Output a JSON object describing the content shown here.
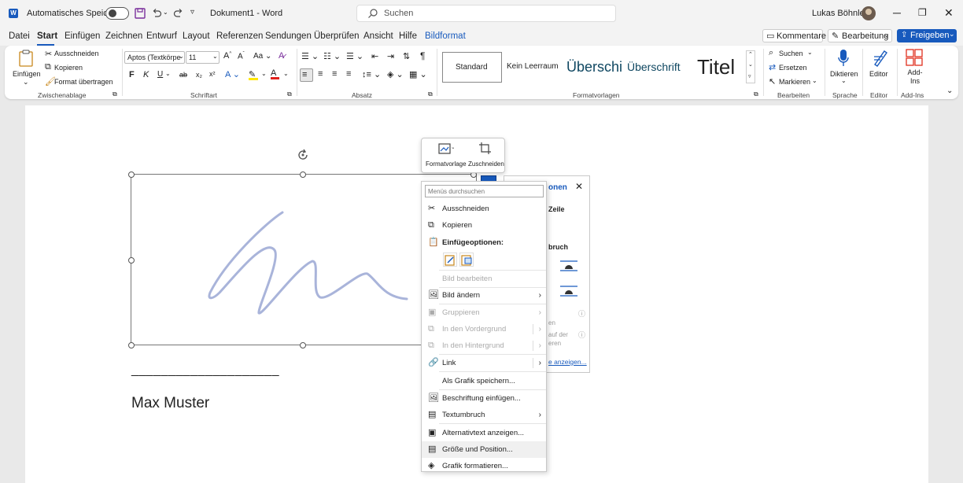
{
  "titlebar": {
    "autosave_label": "Automatisches Speichern",
    "doc_title": "Dokument1  -  Word",
    "search_placeholder": "Suchen",
    "user_name": "Lukas Böhnlein"
  },
  "menu_tabs": [
    "Datei",
    "Start",
    "Einfügen",
    "Zeichnen",
    "Entwurf",
    "Layout",
    "Referenzen",
    "Sendungen",
    "Überprüfen",
    "Ansicht",
    "Hilfe",
    "Bildformat"
  ],
  "active_tab": "Start",
  "right_buttons": {
    "comments": "Kommentare",
    "editing": "Bearbeitung",
    "share": "Freigeben"
  },
  "ribbon": {
    "clipboard": {
      "paste": "Einfügen",
      "cut": "Ausschneiden",
      "copy": "Kopieren",
      "format_painter": "Format übertragen",
      "label": "Zwischenablage"
    },
    "font": {
      "name": "Aptos (Textkörpe",
      "size": "11",
      "label": "Schriftart",
      "bold": "F",
      "italic": "K",
      "underline": "U",
      "strike": "ab",
      "sub": "x₂",
      "sup": "x²",
      "grow": "A^",
      "shrink": "Aˇ",
      "case": "Aa"
    },
    "paragraph": {
      "label": "Absatz"
    },
    "styles": {
      "items": [
        "Standard",
        "Kein Leerraum",
        "Überschi",
        "Überschrift",
        "Titel"
      ],
      "label": "Formatvorlagen"
    },
    "editing": {
      "find": "Suchen",
      "replace": "Ersetzen",
      "select": "Markieren",
      "label": "Bearbeiten"
    },
    "voice": {
      "dictate": "Diktieren",
      "label": "Sprache"
    },
    "editor": {
      "button": "Editor",
      "label": "Editor"
    },
    "addins": {
      "button": "Add-Ins",
      "label": "Add-Ins"
    }
  },
  "document": {
    "signature_line": "____________________",
    "name": "Max Muster"
  },
  "mini_toolbar": {
    "style": "Formatvorlage",
    "crop": "Zuschneiden"
  },
  "layout_panel": {
    "title": "onen",
    "line": "Zeile",
    "wrap": "bruch",
    "t1": "en",
    "t2": "auf der",
    "t3": "eren",
    "link": "e anzeigen..."
  },
  "context_menu": {
    "search_placeholder": "Menüs durchsuchen",
    "items": {
      "cut": "Ausschneiden",
      "copy": "Kopieren",
      "paste_options": "Einfügeoptionen:",
      "edit_image": "Bild bearbeiten",
      "change_image": "Bild ändern",
      "group": "Gruppieren",
      "bring_forward": "In den Vordergrund",
      "send_back": "In den Hintergrund",
      "link": "Link",
      "save_as": "Als Grafik speichern...",
      "caption": "Beschriftung einfügen...",
      "wrap": "Textumbruch",
      "alt_text": "Alternativtext anzeigen...",
      "size_pos": "Größe und Position...",
      "format": "Grafik formatieren..."
    }
  },
  "colors": {
    "accent": "#185abd",
    "word_blue": "#2b579a",
    "purple": "#7a2f9c"
  }
}
